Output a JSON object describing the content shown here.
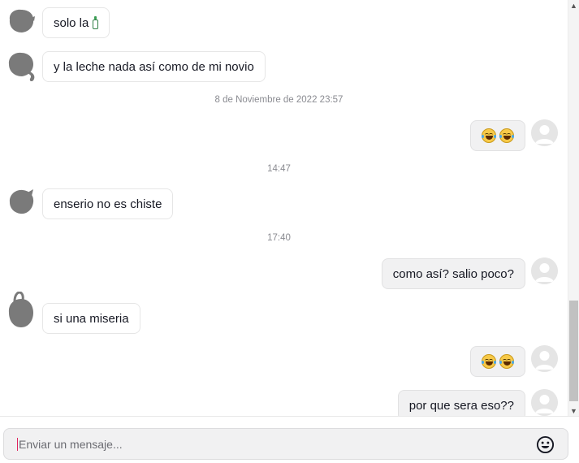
{
  "messages": [
    {
      "direction": "in",
      "text": "solo la",
      "icon": "milk-bottle-icon"
    },
    {
      "direction": "in",
      "text": "y la leche nada así como de mi novio"
    },
    {
      "direction": "out",
      "emojis": [
        "laughing-tears-emoji",
        "laughing-tears-emoji"
      ]
    },
    {
      "direction": "in",
      "text": "enserio  no es chiste"
    },
    {
      "direction": "out",
      "text": "como así? salio poco?"
    },
    {
      "direction": "in",
      "text": "si una miseria"
    },
    {
      "direction": "out",
      "emojis": [
        "laughing-tears-emoji",
        "laughing-tears-emoji"
      ]
    },
    {
      "direction": "out",
      "text": "por que sera eso??"
    }
  ],
  "timestamps": [
    "8 de Noviembre de 2022 23:57",
    "14:47",
    "17:40"
  ],
  "composer": {
    "placeholder": "Enviar un mensaje...",
    "emoji_button_icon": "smiley-icon"
  },
  "colors": {
    "incoming_bubble": "#ffffff",
    "outgoing_bubble": "#f1f1f2",
    "timestamp_text": "#8a8b91",
    "caret": "#e0245e"
  }
}
